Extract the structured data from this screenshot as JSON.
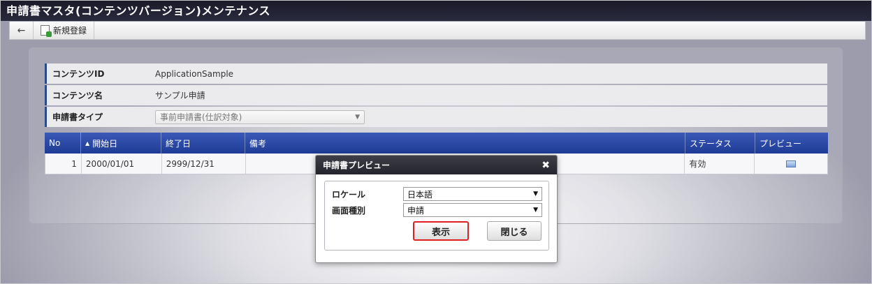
{
  "window": {
    "title": "申請書マスタ(コンテンツバージョン)メンテナンス"
  },
  "toolbar": {
    "back_icon": "←",
    "new_label": "新規登録"
  },
  "form": {
    "content_id_label": "コンテンツID",
    "content_id_value": "ApplicationSample",
    "content_name_label": "コンテンツ名",
    "content_name_value": "サンプル申請",
    "type_label": "申請書タイプ",
    "type_value": "事前申請書(仕訳対象)"
  },
  "grid": {
    "headers": {
      "no": "No",
      "start": "開始日",
      "end": "終了日",
      "memo": "備考",
      "status": "ステータス",
      "preview": "プレビュー"
    },
    "rows": [
      {
        "no": "1",
        "start": "2000/01/01",
        "end": "2999/12/31",
        "memo": "",
        "status": "有効"
      }
    ]
  },
  "dialog": {
    "title": "申請書プレビュー",
    "close_icon": "✖",
    "locale_label": "ロケール",
    "locale_value": "日本語",
    "screen_type_label": "画面種別",
    "screen_type_value": "申請",
    "show_button": "表示",
    "close_button": "閉じる"
  },
  "colors": {
    "title_bar": "#1a1a2a",
    "grid_header": "#2a4a9e",
    "highlight": "#e02020"
  }
}
